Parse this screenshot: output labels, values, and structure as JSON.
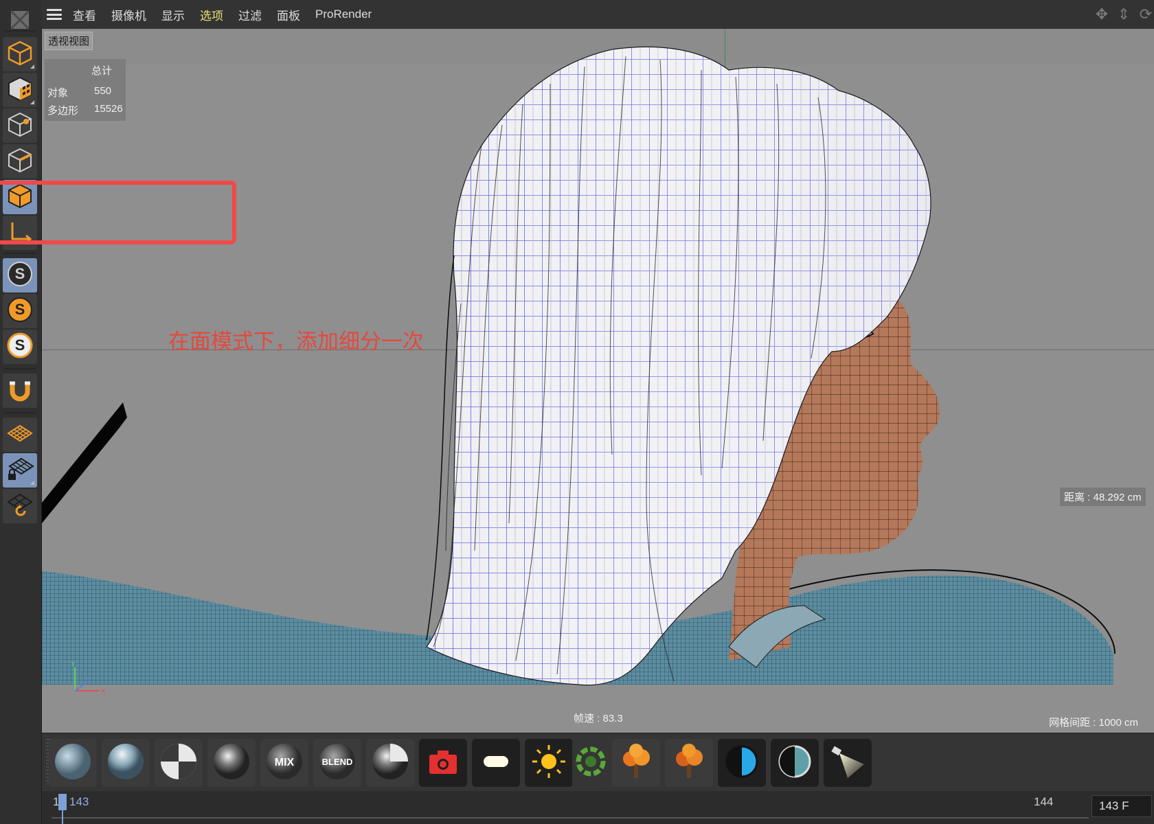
{
  "menu": {
    "items": [
      "查看",
      "摄像机",
      "显示",
      "选项",
      "过滤",
      "面板",
      "ProRender"
    ],
    "selected_index": 3
  },
  "viewport": {
    "title": "透视视图",
    "stats": {
      "header": "总计",
      "objects_label": "对象",
      "objects_value": "550",
      "polygons_label": "多边形",
      "polygons_value": "15526"
    },
    "distance": "距离 : 48.292 cm",
    "fps": "帧速 : 83.3",
    "grid_spacing": "网格间距 : 1000 cm",
    "annotation": "在面模式下，添加细分一次"
  },
  "left_toolbar": {
    "tools": [
      {
        "icon": "model-mode-icon",
        "active": false
      },
      {
        "icon": "texture-mode-icon",
        "active": false
      },
      {
        "icon": "point-mode-icon",
        "active": false
      },
      {
        "icon": "edge-mode-icon",
        "active": false
      },
      {
        "icon": "polygon-mode-icon",
        "active": true
      },
      {
        "icon": "axis-mode-icon",
        "active": false
      },
      {
        "icon": "solo-off-icon",
        "active": true
      },
      {
        "icon": "solo-single-icon",
        "active": false
      },
      {
        "icon": "solo-hierarchy-icon",
        "active": false
      },
      {
        "icon": "snap-magnet-icon",
        "active": false
      },
      {
        "icon": "workplane-icon",
        "active": false
      },
      {
        "icon": "locked-workplane-icon",
        "active": true
      },
      {
        "icon": "workplane-rotate-icon",
        "active": false
      }
    ]
  },
  "shelf": {
    "items": [
      "material-sphere-icon",
      "glass-sphere-icon",
      "checker-sphere-icon",
      "chrome-sphere-icon",
      "mix-material-icon",
      "blend-material-icon",
      "split-sphere-icon",
      "camera-icon",
      "area-light-icon",
      "sun-light-icon",
      "environment-icon",
      "tree-icon",
      "tree-alt-icon",
      "contrast-icon",
      "contrast-alt-icon",
      "spotlight-icon"
    ],
    "mix_label": "MIX",
    "blend_label": "BLEND"
  },
  "timeline": {
    "start": "1",
    "current": "143",
    "end": "144",
    "frame_field": "143 F"
  },
  "colors": {
    "accent_orange": "#f09a2a",
    "active_blue": "#7b93b8",
    "annotation_red": "#e4493f",
    "menu_selected": "#e9e07a"
  }
}
